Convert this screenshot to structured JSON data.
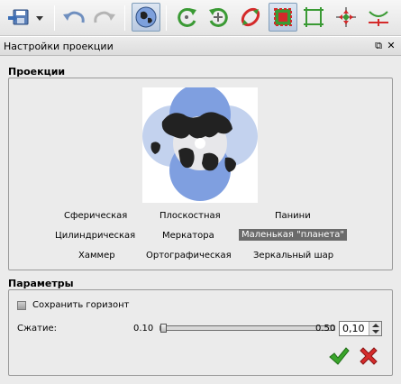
{
  "panel": {
    "title": "Настройки проекции"
  },
  "projections": {
    "heading": "Проекции",
    "options": [
      {
        "label": "Сферическая"
      },
      {
        "label": "Плоскостная"
      },
      {
        "label": "Панини"
      },
      {
        "label": "Цилиндрическая"
      },
      {
        "label": "Меркатора"
      },
      {
        "label": "Маленькая \"планета\""
      },
      {
        "label": "Хаммер"
      },
      {
        "label": "Ортографическая"
      },
      {
        "label": "Зеркальный шар"
      }
    ],
    "selected": "Маленькая \"планета\""
  },
  "parameters": {
    "heading": "Параметры",
    "keep_horizon_label": "Сохранить горизонт",
    "keep_horizon_checked": false,
    "compression_label": "Сжатие:",
    "slider_min_label": "0.10",
    "slider_max_label": "0.50",
    "slider_value_fraction": 0.0,
    "spin_value": "0,10"
  },
  "toolbar": {
    "icons": [
      "save-icon",
      "dropdown-arrow-icon",
      "undo-icon",
      "redo-icon",
      "projection-globe-icon",
      "rotate-left-icon",
      "rotate-right-icon",
      "flip-icon",
      "crop-select-icon",
      "crop-icon",
      "align-icon",
      "straighten-icon"
    ]
  },
  "colors": {
    "selection": "#6b6b6b",
    "accept": "#3aa52b",
    "cancel": "#d62b2b"
  }
}
